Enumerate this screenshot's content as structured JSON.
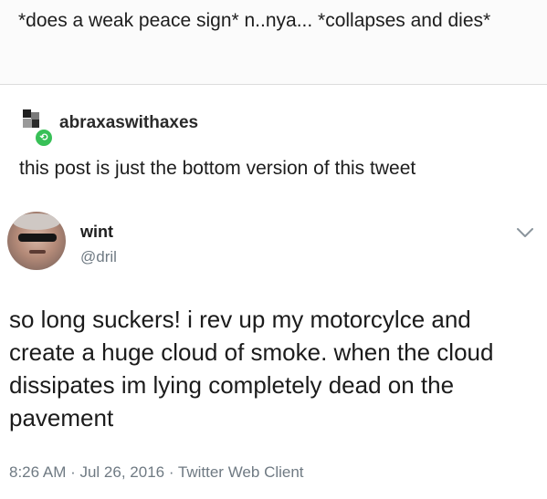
{
  "top_post": {
    "text": "*does a weak peace sign* n..nya... *collapses and dies*"
  },
  "reblog": {
    "username": "abraxaswithaxes",
    "comment": "this post is just the bottom version of this tweet",
    "badge_icon": "reblog-icon",
    "badge_color": "#38c057"
  },
  "tweet": {
    "display_name": "wint",
    "handle": "@dril",
    "body": "so long suckers! i rev up my motorcylce and create a huge cloud of smoke. when the cloud dissipates im lying completely dead on the pavement",
    "meta": "8:26 AM · Jul 26, 2016 · Twitter Web Client",
    "menu_icon": "chevron-down-icon"
  }
}
